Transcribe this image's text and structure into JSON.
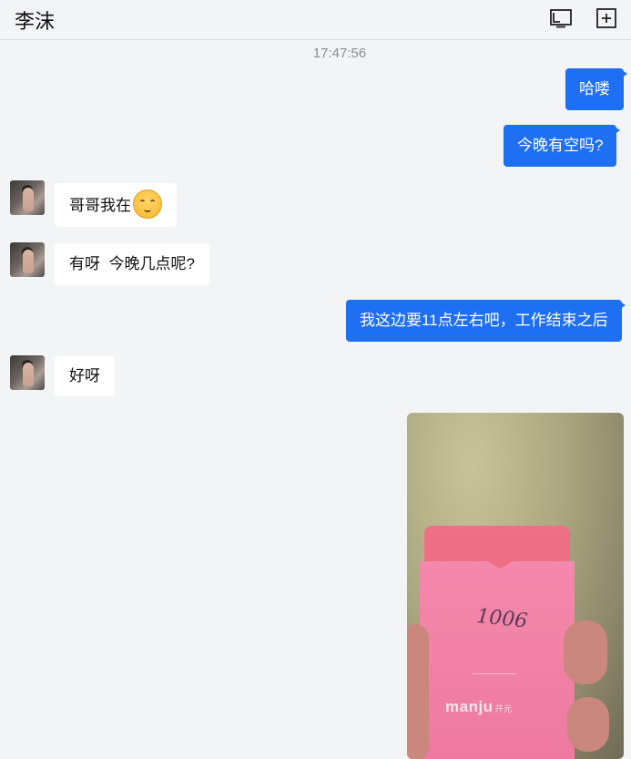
{
  "header": {
    "title": "李沫",
    "icons": [
      "screen-icon",
      "add-icon"
    ]
  },
  "timestamp": "17:47:56",
  "messages": [
    {
      "side": "out",
      "text": "哈喽"
    },
    {
      "side": "out",
      "text": "今晚有空吗?"
    },
    {
      "side": "in",
      "text": "哥哥我在",
      "emoji": "relieved-face-emoji"
    },
    {
      "side": "in",
      "text": "有呀  今晚几点呢?"
    },
    {
      "side": "out",
      "text": "我这边要11点左右吧，工作结束之后"
    },
    {
      "side": "in",
      "text": "好呀"
    },
    {
      "side": "out",
      "type": "image",
      "handwriting": "1006",
      "logo_text": "manju",
      "logo_sub": "开元"
    }
  ],
  "colors": {
    "background": "#f3f4f6",
    "outgoing_bubble": "#1e6ff1",
    "incoming_bubble": "#ffffff"
  }
}
